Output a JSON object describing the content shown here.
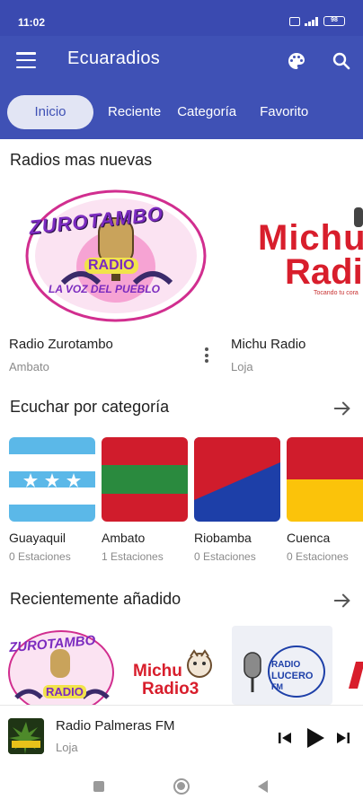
{
  "status_bar": {
    "time": "11:02",
    "battery": "98"
  },
  "app": {
    "title": "Ecuaradios",
    "accent": "#3f51b5"
  },
  "tabs": [
    {
      "label": "Inicio",
      "active": true
    },
    {
      "label": "Reciente"
    },
    {
      "label": "Categoría"
    },
    {
      "label": "Favorito"
    }
  ],
  "newest": {
    "title": "Radios mas nuevas",
    "radios": [
      {
        "name": "Radio Zurotambo",
        "city": "Ambato",
        "logo_text": [
          "ZUROTAMBO",
          "RADIO",
          "LA VOZ DEL PUEBLO"
        ]
      },
      {
        "name": "Michu Radio",
        "city": "Loja",
        "logo_text": [
          "Michu",
          "Radi",
          "Tocando tu cora"
        ]
      }
    ]
  },
  "categories": {
    "title": "Ecuchar por categoría",
    "items": [
      {
        "name": "Guayaquil",
        "count": "0 Estaciones"
      },
      {
        "name": "Ambato",
        "count": "1 Estaciones"
      },
      {
        "name": "Riobamba",
        "count": "0 Estaciones"
      },
      {
        "name": "Cuenca",
        "count": "0 Estaciones"
      }
    ]
  },
  "recent": {
    "title": "Recientemente añadido",
    "logos": [
      {
        "text": [
          "ZUROTAMBO",
          "RADIO"
        ]
      },
      {
        "text": [
          "Michu",
          "Radio3"
        ]
      },
      {
        "text": [
          "RADIO",
          "LUCERO",
          "FM"
        ]
      }
    ]
  },
  "player": {
    "name": "Radio Palmeras FM",
    "city": "Loja"
  }
}
